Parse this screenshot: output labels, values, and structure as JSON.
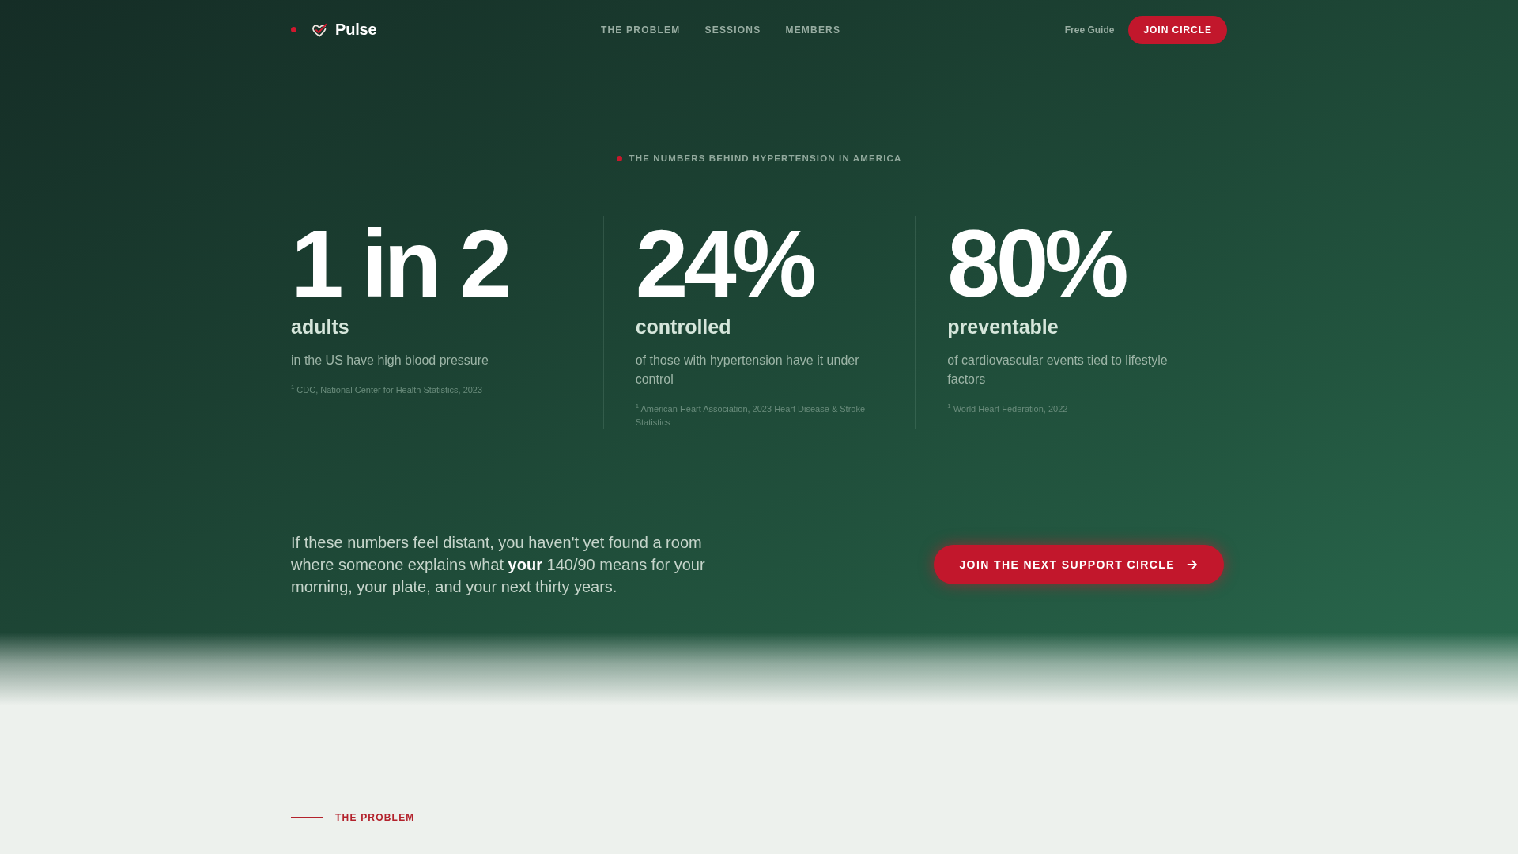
{
  "header": {
    "brand": "Pulse",
    "nav": [
      "THE PROBLEM",
      "SESSIONS",
      "MEMBERS"
    ],
    "free_guide": "Free Guide",
    "join_button": "JOIN CIRCLE"
  },
  "hero": {
    "eyebrow": "THE NUMBERS BEHIND HYPERTENSION IN AMERICA",
    "stats": [
      {
        "value": "1 in 2",
        "label": "adults",
        "description": "in the US have high blood pressure",
        "source": "$^{1}$ CDC, National Center for Health Statistics, 2023"
      },
      {
        "value": "24%",
        "label": "controlled",
        "description": "of those with hypertension have it under control",
        "source": "$^{1}$ American Heart Association, 2023 Heart Disease & Stroke Statistics"
      },
      {
        "value": "80%",
        "label": "preventable",
        "description": "of cardiovascular events tied to lifestyle factors",
        "source": "$^{1}$ World Heart Federation, 2022"
      }
    ],
    "cta": {
      "text": "If these numbers feel distant, you haven't yet found a room where someone explains what **your** 140/90 means for your morning, your plate, and your next thirty years.",
      "button": "JOIN THE NEXT SUPPORT CIRCLE"
    }
  },
  "problem_section": {
    "label": "THE PROBLEM"
  }
}
